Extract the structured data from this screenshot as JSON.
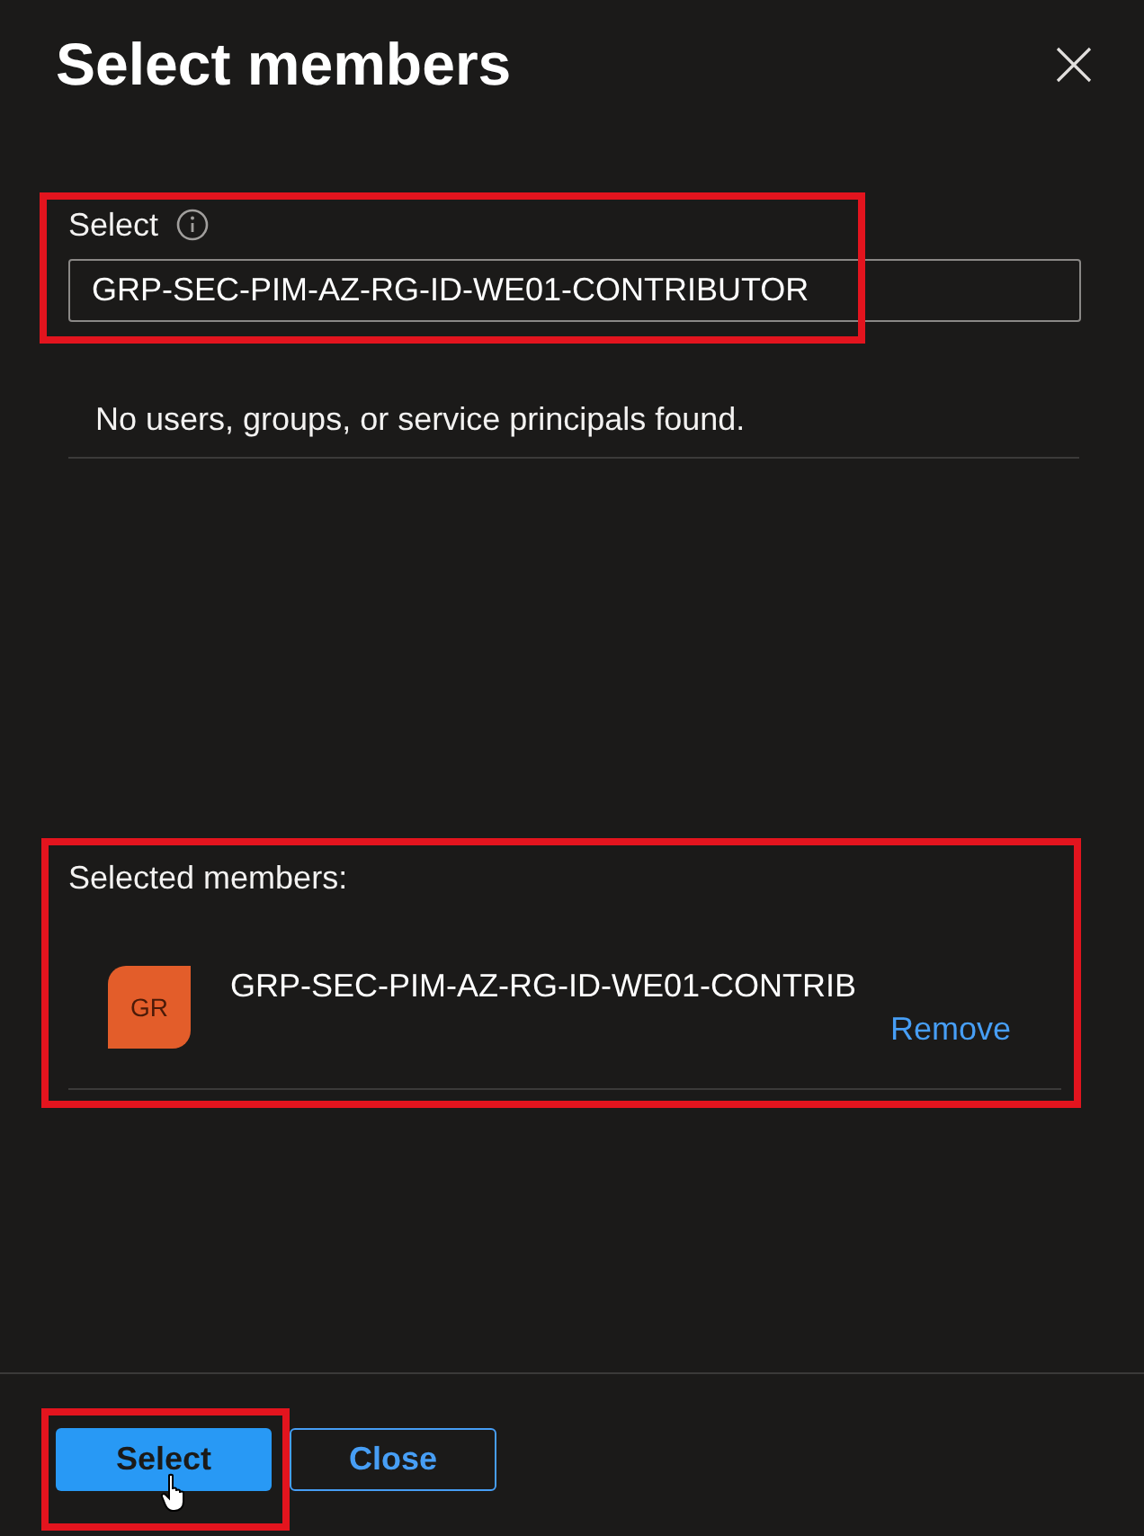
{
  "panel": {
    "title": "Select members"
  },
  "search": {
    "label": "Select",
    "value": "GRP-SEC-PIM-AZ-RG-ID-WE01-CONTRIBUTOR",
    "highlighted": true
  },
  "results": {
    "message": "No users, groups, or service principals found."
  },
  "selected_members": {
    "heading": "Selected members:",
    "highlighted": true,
    "items": [
      {
        "initials": "GR",
        "name": "GRP-SEC-PIM-AZ-RG-ID-WE01-CONTRIB",
        "action": "Remove"
      }
    ]
  },
  "footer": {
    "buttons": [
      {
        "label": "Select",
        "kind": "primary",
        "highlighted": true
      },
      {
        "label": "Close",
        "kind": "secondary",
        "highlighted": false
      }
    ]
  }
}
